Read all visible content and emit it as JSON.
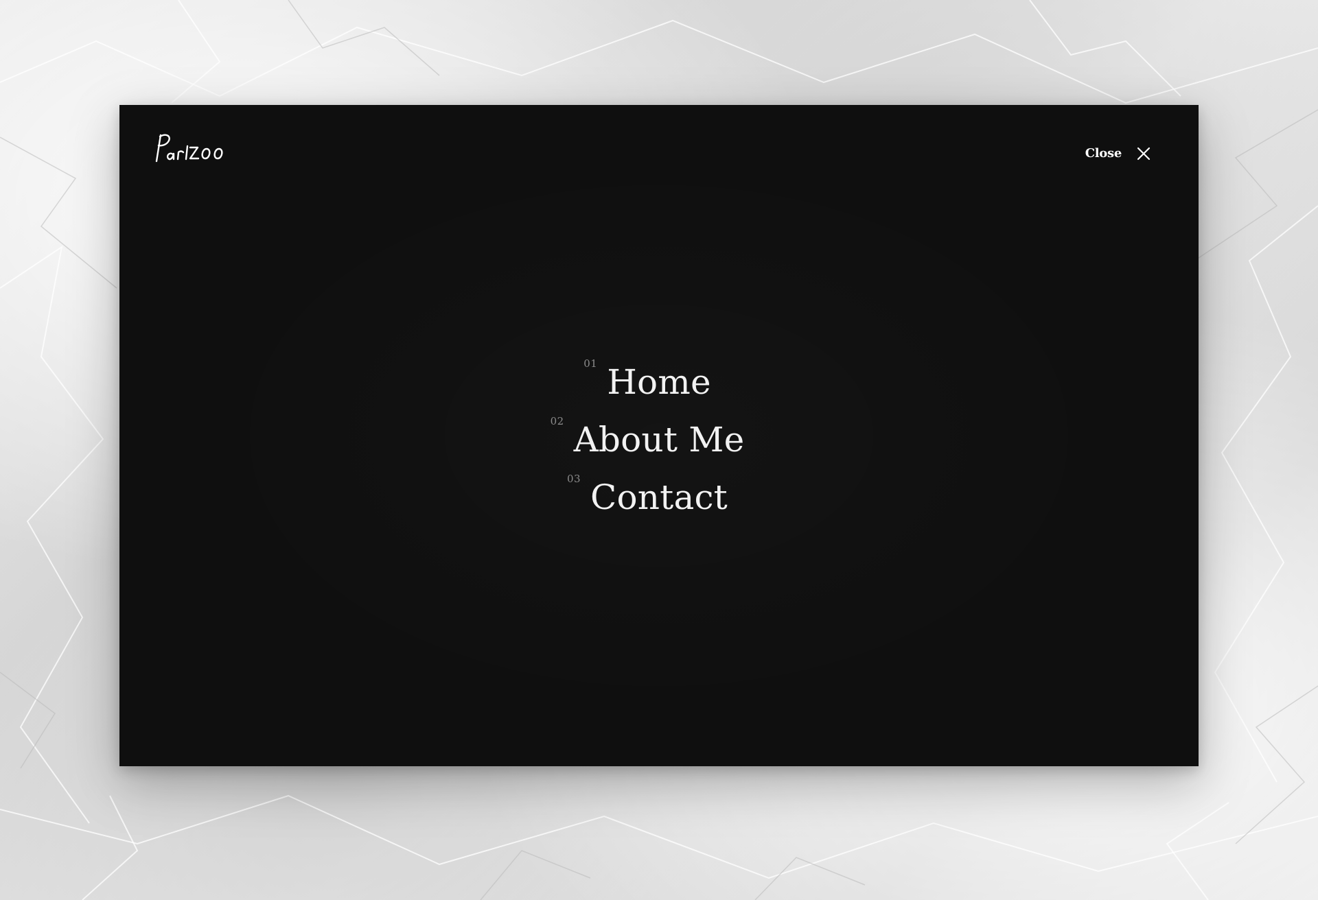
{
  "header": {
    "logo_text": "Parizoo",
    "close_label": "Close"
  },
  "nav": {
    "items": [
      {
        "num": "01",
        "label": "Home"
      },
      {
        "num": "02",
        "label": "About Me"
      },
      {
        "num": "03",
        "label": "Contact"
      }
    ]
  },
  "icons": {
    "close": "close-icon",
    "logo": "logo-wordmark"
  },
  "colors": {
    "overlay_bg": "#0f0f0f",
    "text_primary": "#f2f2f2",
    "text_muted": "#8a8a8a",
    "page_bg": "#e4e4e4"
  }
}
